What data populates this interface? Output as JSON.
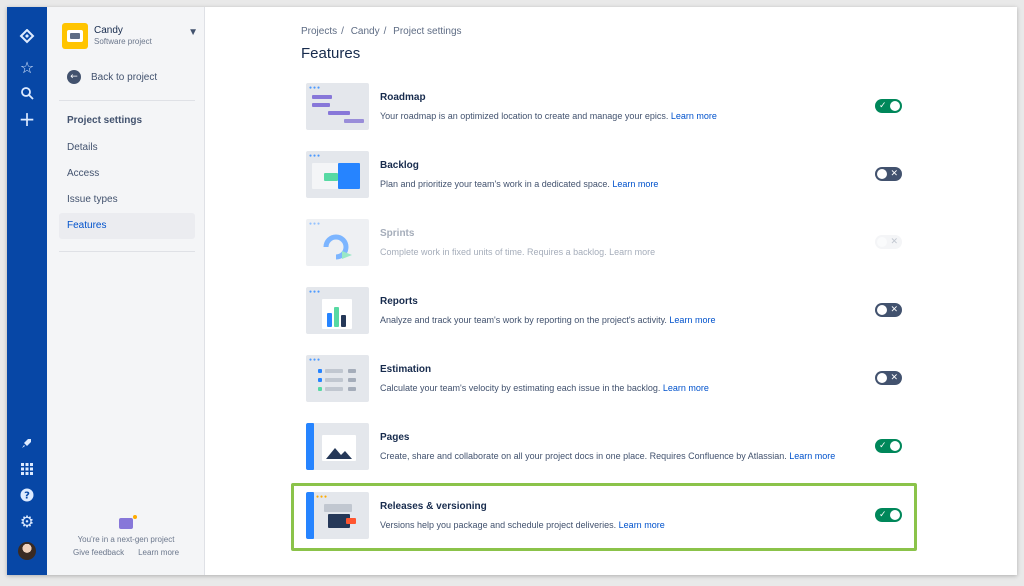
{
  "sidebar": {
    "project_name": "Candy",
    "project_type": "Software project",
    "back_label": "Back to project",
    "section_title": "Project settings",
    "items": [
      {
        "label": "Details",
        "active": false
      },
      {
        "label": "Access",
        "active": false
      },
      {
        "label": "Issue types",
        "active": false
      },
      {
        "label": "Features",
        "active": true
      }
    ],
    "footer_text": "You're in a next-gen project",
    "feedback_label": "Give feedback",
    "learn_more_label": "Learn more"
  },
  "breadcrumbs": [
    "Projects",
    "Candy",
    "Project settings"
  ],
  "page_title": "Features",
  "learn_more": "Learn more",
  "features": [
    {
      "name": "Roadmap",
      "description": "Your roadmap is an optimized location to create and manage your epics.",
      "state": "on"
    },
    {
      "name": "Backlog",
      "description": "Plan and prioritize your team's work in a dedicated space.",
      "state": "off"
    },
    {
      "name": "Sprints",
      "description": "Complete work in fixed units of time. Requires a backlog.",
      "state": "disabled"
    },
    {
      "name": "Reports",
      "description": "Analyze and track your team's work by reporting on the project's activity.",
      "state": "off"
    },
    {
      "name": "Estimation",
      "description": "Calculate your team's velocity by estimating each issue in the backlog.",
      "state": "off"
    },
    {
      "name": "Pages",
      "description": "Create, share and collaborate on all your project docs in one place. Requires Confluence by Atlassian.",
      "state": "on"
    },
    {
      "name": "Releases & versioning",
      "description": "Versions help you package and schedule project deliveries.",
      "state": "on"
    }
  ],
  "icons": {
    "gnav": [
      "jira-logo-icon",
      "star-icon",
      "search-icon",
      "plus-icon",
      "rocket-icon",
      "app-switcher-icon",
      "help-icon",
      "settings-icon"
    ],
    "toggle_on": "check-icon",
    "toggle_off": "cross-icon"
  },
  "colors": {
    "nav": "#0747a6",
    "toggle_on": "#00875a",
    "toggle_off": "#42526e",
    "highlight": "#8bc34a",
    "link": "#0052cc"
  }
}
